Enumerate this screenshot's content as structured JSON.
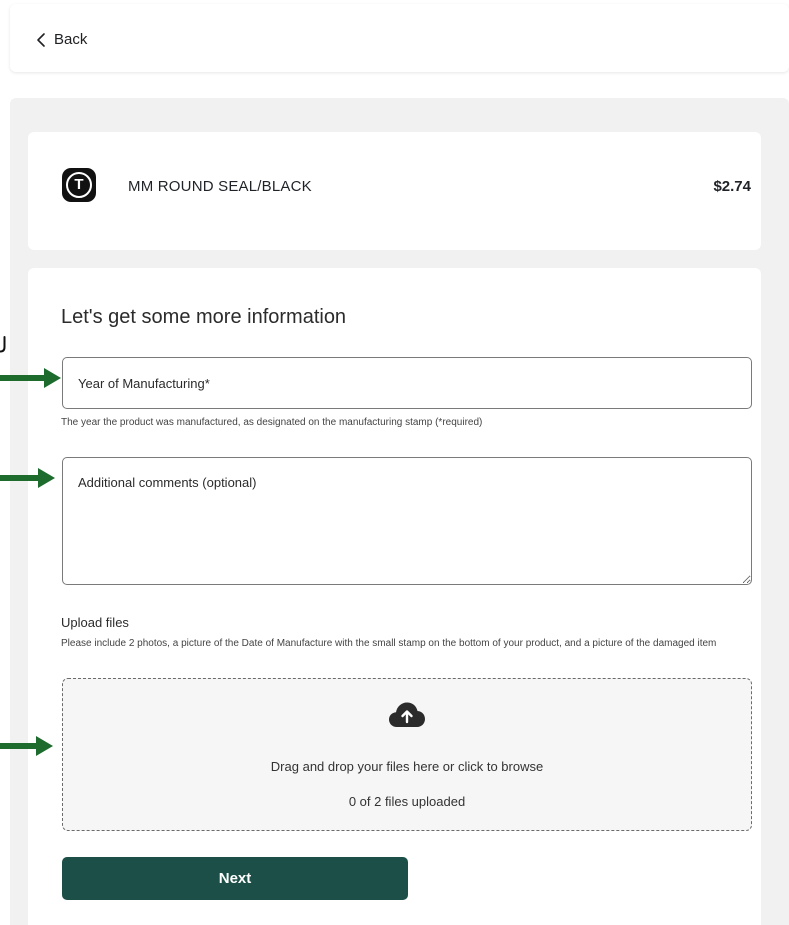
{
  "header": {
    "back_label": "Back"
  },
  "product": {
    "name": "MM ROUND SEAL/BLACK",
    "price": "$2.74",
    "logo_letter": "T"
  },
  "form": {
    "title": "Let's get some more information",
    "year_field": {
      "placeholder": "Year of Manufacturing*",
      "value": ""
    },
    "year_helper": "The year the product was manufactured, as designated on the manufacturing stamp (*required)",
    "comments_field": {
      "placeholder": "Additional comments (optional)",
      "value": ""
    },
    "upload": {
      "title": "Upload files",
      "help": "Please include 2 photos, a picture of the Date of Manufacture with the small stamp on the bottom of your product, and a picture of the damaged item",
      "drop_text": "Drag and drop your files here or click to browse",
      "count_text": "0 of 2 files uploaded"
    },
    "next_label": "Next"
  },
  "annotations": {
    "arrow_color": "#1e6b2e"
  },
  "colors": {
    "button": "#1b4f47",
    "panel": "#f1f1f1"
  }
}
